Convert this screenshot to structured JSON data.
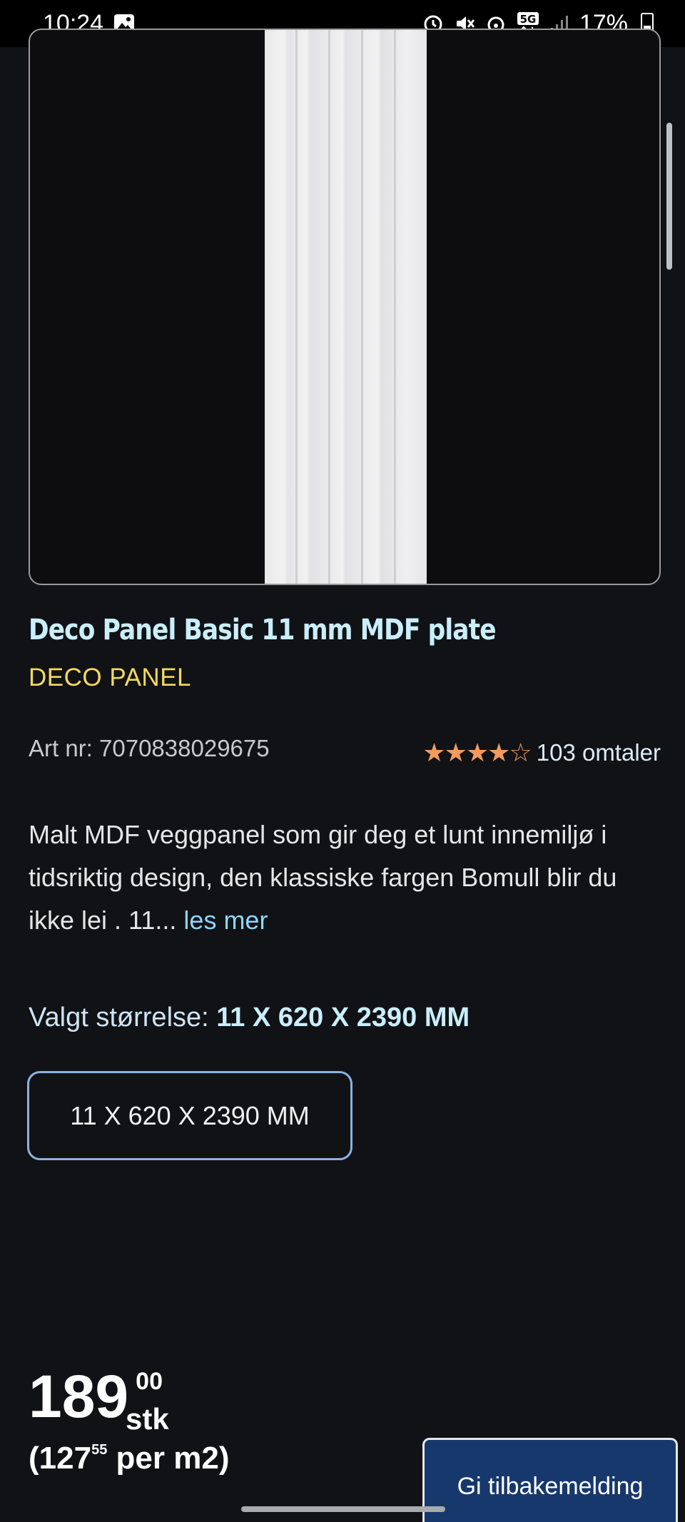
{
  "status_bar": {
    "time": "10:24",
    "battery": "17%",
    "icons": [
      "gallery-icon",
      "alarm-icon",
      "mute-icon",
      "hotspot-icon",
      "5g-icon",
      "signal-icon",
      "battery-icon"
    ]
  },
  "product": {
    "title": "Deco Panel Basic 11 mm MDF plate",
    "brand": "DECO PANEL",
    "art_nr": "Art nr: 7070838029675",
    "rating_stars": "★★★★☆",
    "rating_value": 4.5,
    "reviews": "103 omtaler",
    "description": "Malt MDF veggpanel som gir deg et lunt innemiljø i tidsriktig design, den klassiske fargen Bomull blir du ikke lei . 11...",
    "read_more": "les mer"
  },
  "size": {
    "label": "Valgt størrelse:",
    "selected": "11 X 620 X 2390 MM",
    "option": "11 X 620 X 2390 MM"
  },
  "price": {
    "integer": "189",
    "decimals": "00",
    "unit": "stk",
    "per_open": "(127",
    "per_decimals": "55",
    "per_unit": " per m2)"
  },
  "feedback_button": "Gi tilbakemelding",
  "colors": {
    "background": "#111215",
    "title": "#c9eefc",
    "brand": "#f4d95f",
    "stars": "#f39a5f",
    "link": "#8fd6ff",
    "button": "#17386c"
  }
}
